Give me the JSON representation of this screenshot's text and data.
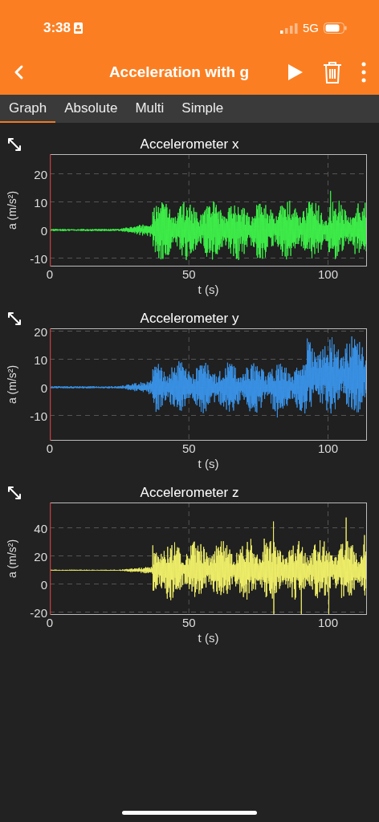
{
  "status_bar": {
    "time": "3:38",
    "network": "5G"
  },
  "nav": {
    "title": "Acceleration with g"
  },
  "tabs": [
    {
      "label": "Graph",
      "selected": true
    },
    {
      "label": "Absolute",
      "selected": false
    },
    {
      "label": "Multi",
      "selected": false
    },
    {
      "label": "Simple",
      "selected": false
    }
  ],
  "graphs": [
    {
      "title": "Accelerometer x",
      "ylabel": "a (m/s²)",
      "xlabel": "t (s)",
      "color": "#3ef04a",
      "yticks": [
        "20",
        "10",
        "0",
        "-10"
      ],
      "xticks": [
        "0",
        "50",
        "100"
      ]
    },
    {
      "title": "Accelerometer y",
      "ylabel": "a (m/s²)",
      "xlabel": "t (s)",
      "color": "#3a93e8",
      "yticks": [
        "20",
        "10",
        "0",
        "-10"
      ],
      "xticks": [
        "0",
        "50",
        "100"
      ]
    },
    {
      "title": "Accelerometer z",
      "ylabel": "a (m/s²)",
      "xlabel": "t (s)",
      "color": "#f2f06a",
      "yticks": [
        "40",
        "20",
        "0",
        "-20"
      ],
      "xticks": [
        "0",
        "50",
        "100"
      ]
    }
  ]
}
